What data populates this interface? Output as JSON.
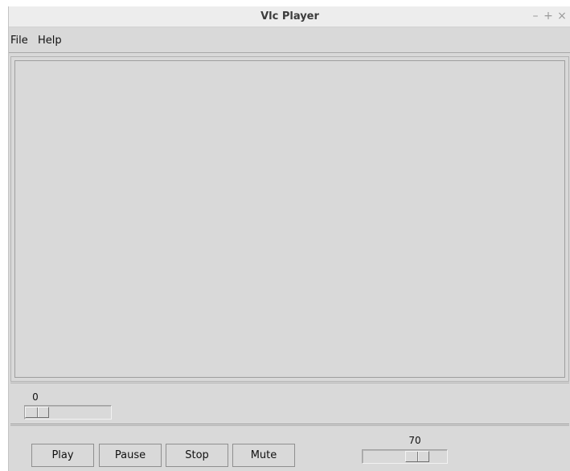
{
  "window": {
    "title": "Vlc Player",
    "controls": {
      "minimize": "–",
      "maximize": "+",
      "close": "×"
    }
  },
  "menu": {
    "items": [
      {
        "label": "File"
      },
      {
        "label": "Help"
      }
    ]
  },
  "seek": {
    "value": "0",
    "position_fraction": 0.0
  },
  "controls": {
    "play_label": "Play",
    "pause_label": "Pause",
    "stop_label": "Stop",
    "mute_label": "Mute"
  },
  "volume": {
    "value": "70",
    "position_fraction": 0.7
  },
  "icons": {
    "minimize": "minimize-icon",
    "maximize": "maximize-icon",
    "close": "close-icon"
  },
  "colors": {
    "window_bg": "#d9d9d9",
    "titlebar_bg": "#ededed"
  }
}
